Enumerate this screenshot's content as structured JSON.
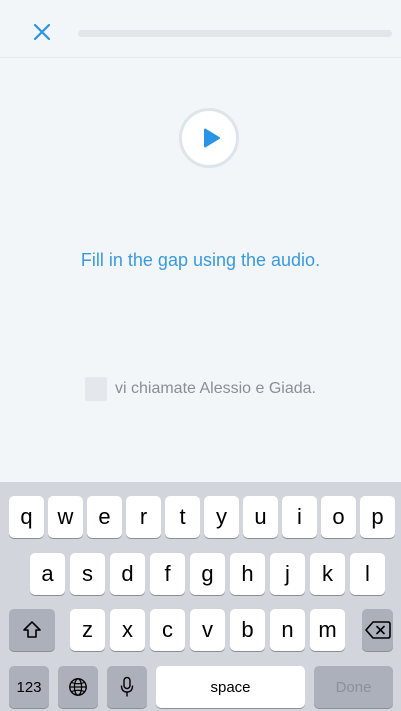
{
  "header": {
    "close_icon": "close-icon",
    "progress_fraction": 0.0,
    "accent_color": "#2b93e6"
  },
  "exercise": {
    "play_icon": "play-icon",
    "instruction": "Fill in the gap using the audio.",
    "sentence_rest": "vi chiamate Alessio e Giada."
  },
  "keyboard": {
    "row1": [
      "q",
      "w",
      "e",
      "r",
      "t",
      "y",
      "u",
      "i",
      "o",
      "p"
    ],
    "row2": [
      "a",
      "s",
      "d",
      "f",
      "g",
      "h",
      "j",
      "k",
      "l"
    ],
    "row3": [
      "z",
      "x",
      "c",
      "v",
      "b",
      "n",
      "m"
    ],
    "shift_icon": "shift-icon",
    "backspace_icon": "backspace-icon",
    "numbers_label": "123",
    "globe_icon": "globe-icon",
    "mic_icon": "microphone-icon",
    "space_label": "space",
    "done_label": "Done"
  }
}
